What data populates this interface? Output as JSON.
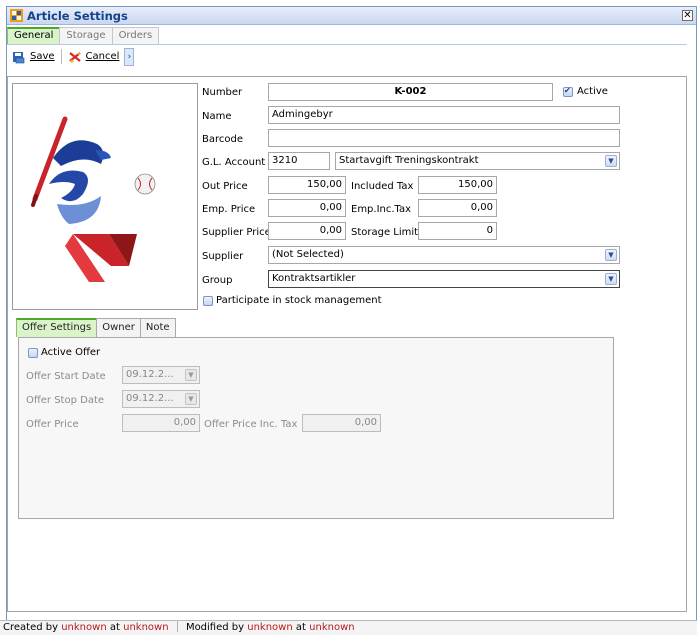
{
  "window": {
    "title": "Article Settings",
    "close_glyph": "✕"
  },
  "tabs": [
    {
      "label": "General",
      "active": true
    },
    {
      "label": "Storage",
      "active": false
    },
    {
      "label": "Orders",
      "active": false
    }
  ],
  "toolbar": {
    "save_label": "Save",
    "cancel_label": "Cancel",
    "more_glyph": "›"
  },
  "form": {
    "number_label": "Number",
    "number_value": "K-002",
    "active_label": "Active",
    "active_checked": true,
    "name_label": "Name",
    "name_value": "Admingebyr",
    "barcode_label": "Barcode",
    "barcode_value": "",
    "gl_label": "G.L. Account",
    "gl_code": "3210",
    "gl_name": "Startavgift Treningskontrakt",
    "out_price_label": "Out Price",
    "out_price_value": "150,00",
    "included_tax_label": "Included Tax",
    "included_tax_value": "150,00",
    "emp_price_label": "Emp. Price",
    "emp_price_value": "0,00",
    "emp_inc_tax_label": "Emp.Inc.Tax",
    "emp_inc_tax_value": "0,00",
    "supplier_price_label": "Supplier Price",
    "supplier_price_value": "0,00",
    "storage_limit_label": "Storage Limit",
    "storage_limit_value": "0",
    "supplier_label": "Supplier",
    "supplier_value": "(Not Selected)",
    "group_label": "Group",
    "group_value": "Kontraktsartikler",
    "stock_mgmt_label": "Participate in stock management",
    "stock_mgmt_checked": false
  },
  "subtabs": [
    {
      "label": "Offer Settings",
      "active": true
    },
    {
      "label": "Owner",
      "active": false
    },
    {
      "label": "Note",
      "active": false
    }
  ],
  "offer": {
    "active_offer_label": "Active Offer",
    "active_offer_checked": false,
    "start_label": "Offer Start Date",
    "start_value": "09.12.2...",
    "stop_label": "Offer Stop Date",
    "stop_value": "09.12.2...",
    "price_label": "Offer Price",
    "price_value": "0,00",
    "price_inc_tax_label": "Offer Price Inc. Tax",
    "price_inc_tax_value": "0,00"
  },
  "status": {
    "created_by_label": "Created by",
    "created_by_value": "unknown",
    "created_at_label": "at",
    "created_at_value": "unknown",
    "modified_by_label": "Modified by",
    "modified_by_value": "unknown",
    "modified_at_label": "at",
    "modified_at_value": "unknown"
  },
  "colors": {
    "accent_green": "#4ea82a",
    "title_blue": "#15428b",
    "status_red": "#b81a1a"
  }
}
